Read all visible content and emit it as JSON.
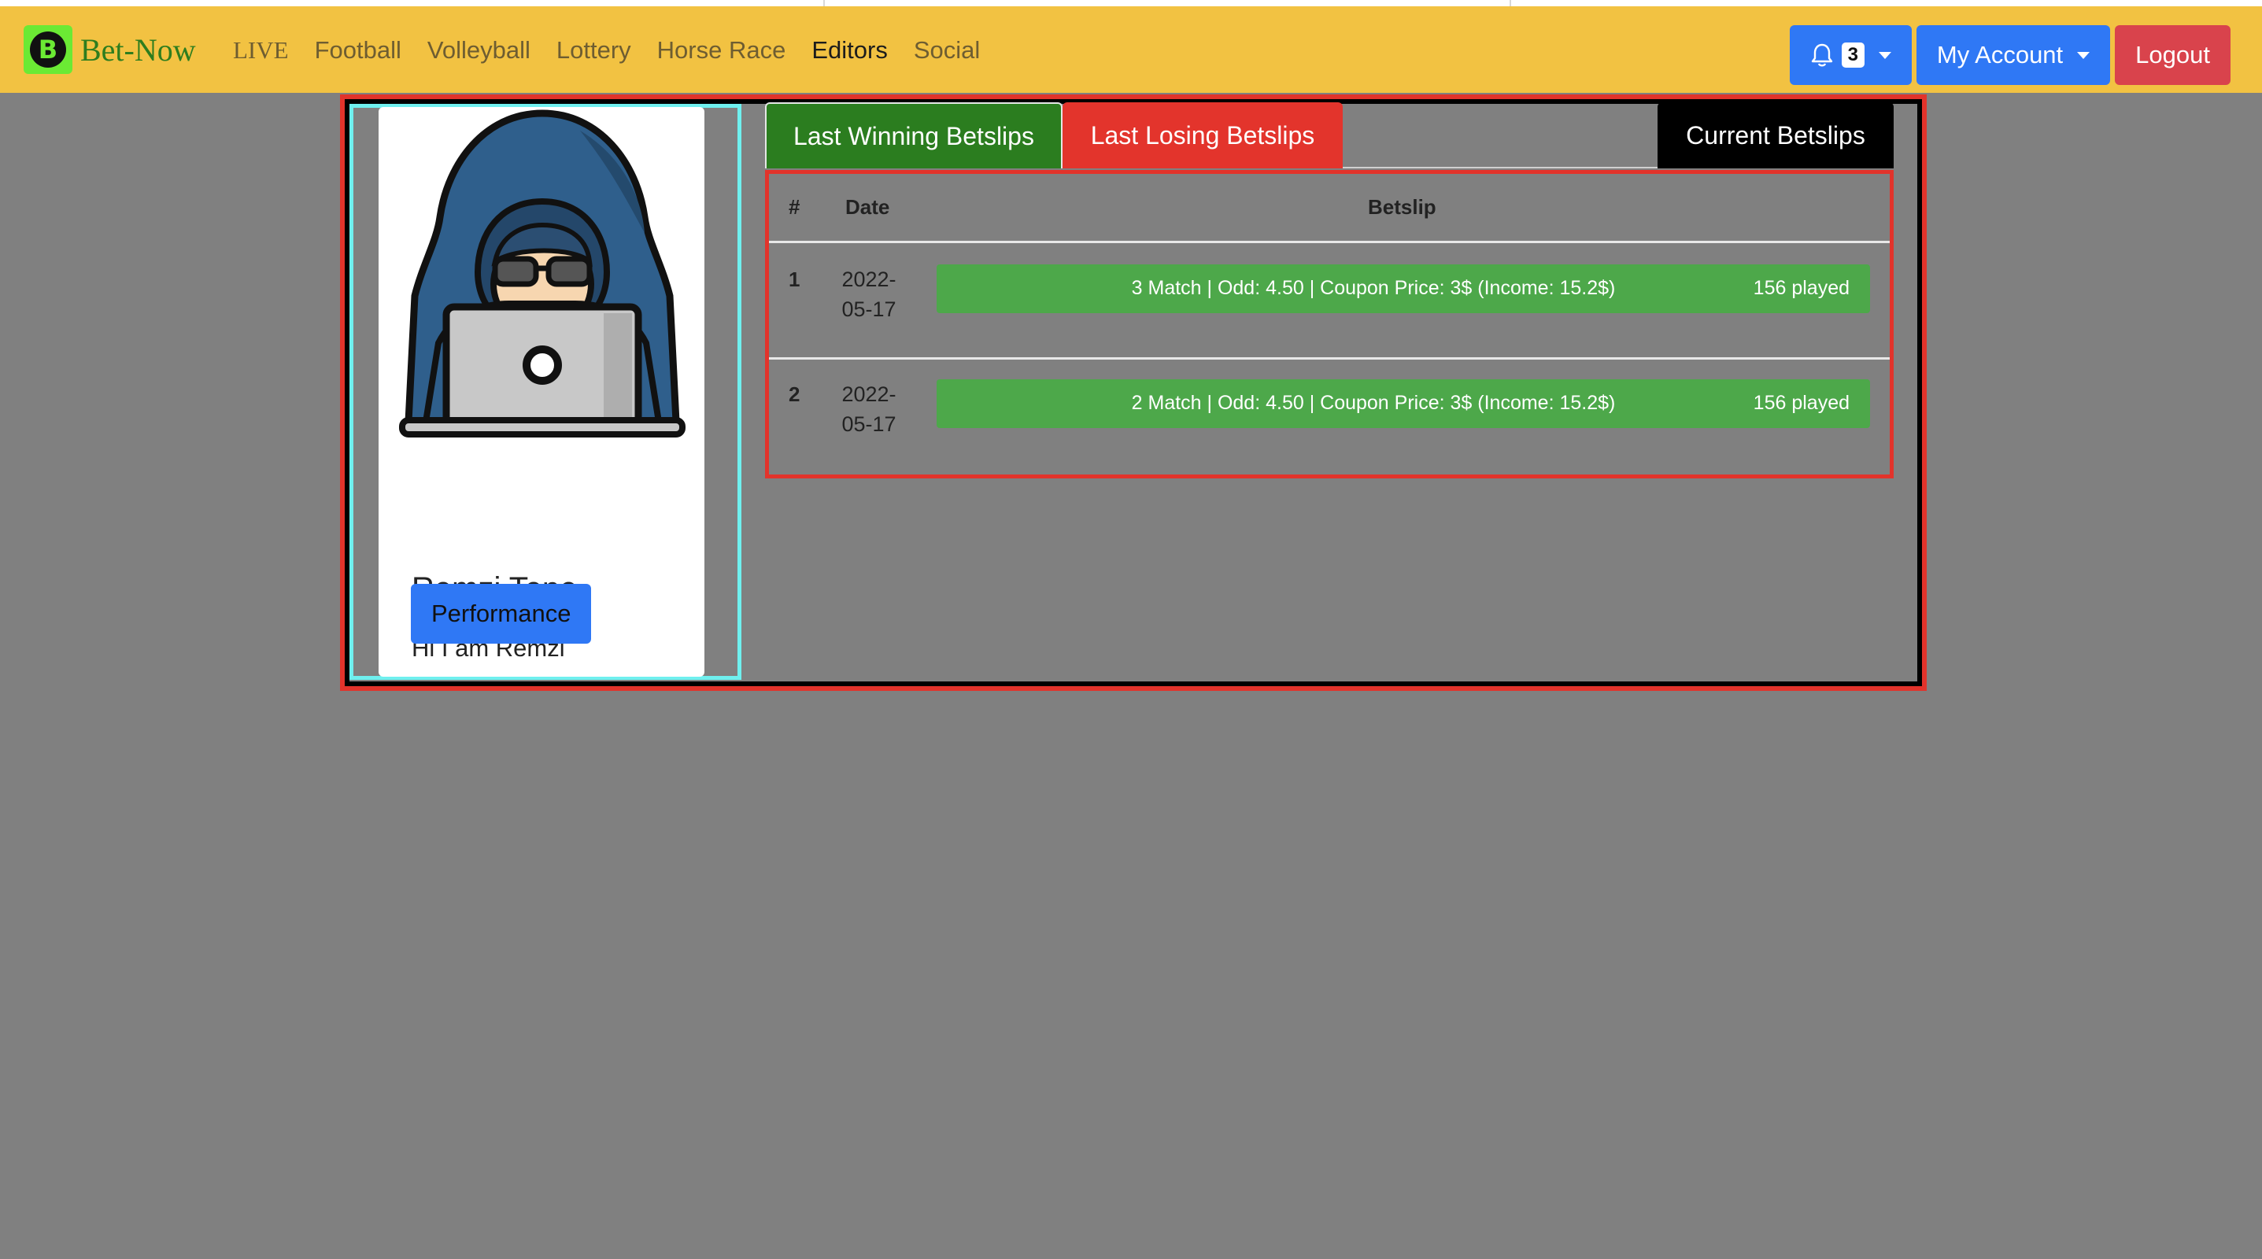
{
  "brand": {
    "logo_letter": "B",
    "name": "Bet-Now"
  },
  "nav": {
    "links": [
      "LIVE",
      "Football",
      "Volleyball",
      "Lottery",
      "Horse Race",
      "Editors",
      "Social"
    ],
    "notifications_count": "3",
    "account_label": "My Account",
    "logout_label": "Logout"
  },
  "profile": {
    "name": "Remzi Tepe",
    "bio": "Hi I am Remzi",
    "performance_label": "Performance"
  },
  "tabs": {
    "winning": "Last Winning Betslips",
    "losing": "Last Losing Betslips",
    "current": "Current Betslips"
  },
  "table": {
    "headers": {
      "num": "#",
      "date": "Date",
      "betslip": "Betslip"
    },
    "rows": [
      {
        "num": "1",
        "date": "2022-05-17",
        "date_l1": "2022-",
        "date_l2": "05-17",
        "desc": "3 Match | Odd: 4.50 | Coupon Price: 3$ (Income: 15.2$)",
        "played": "156 played"
      },
      {
        "num": "2",
        "date": "2022-05-17",
        "date_l1": "2022-",
        "date_l2": "05-17",
        "desc": "2 Match | Odd: 4.50 | Coupon Price: 3$ (Income: 15.2$)",
        "played": "156 played"
      }
    ]
  },
  "colors": {
    "navbar": "#f2c242",
    "primary": "#2f78f5",
    "danger": "#d9434c",
    "winning_tab": "#2b7d1f",
    "losing_tab": "#e3342c",
    "betslip_bar": "#4da84a"
  },
  "icons": {
    "notifications": "bell-icon"
  }
}
